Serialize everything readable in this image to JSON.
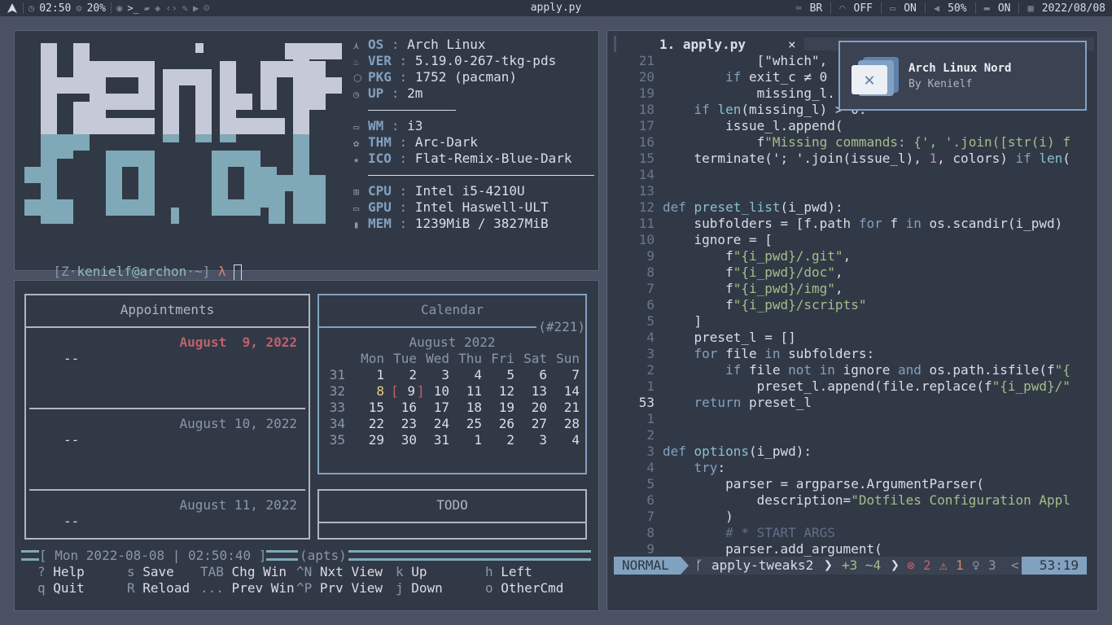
{
  "topbar": {
    "clock": "02:50",
    "cpu": "20%",
    "window_title": "apply.py",
    "keyboard": "BR",
    "wifi": "OFF",
    "display": "ON",
    "volume": "50%",
    "notifications": "ON",
    "date": "2022/08/08"
  },
  "logo": {
    "text": "Kenielf"
  },
  "sysinfo": [
    {
      "icon": "arch-icon",
      "label": "OS",
      "value": "Arch Linux"
    },
    {
      "icon": "flame-icon",
      "label": "VER",
      "value": "5.19.0-267-tkg-pds"
    },
    {
      "icon": "package-icon",
      "label": "PKG",
      "value": "1752 (pacman)"
    },
    {
      "icon": "clock-icon",
      "label": "UP",
      "value": "2m"
    },
    {
      "icon": "window-icon",
      "label": "WM",
      "value": "i3"
    },
    {
      "icon": "palette-icon",
      "label": "THM",
      "value": "Arc-Dark"
    },
    {
      "icon": "star-icon",
      "label": "ICO",
      "value": "Flat-Remix-Blue-Dark"
    },
    {
      "icon": "cpu-icon",
      "label": "CPU",
      "value": "Intel i5-4210U"
    },
    {
      "icon": "monitor-icon",
      "label": "GPU",
      "value": "Intel Haswell-ULT"
    },
    {
      "icon": "memory-icon",
      "label": "MEM",
      "value": "1239MiB / 3827MiB"
    }
  ],
  "prompt": {
    "open": "[Z",
    "user": "kenielf",
    "at": "@",
    "host": "archon",
    "path": "~",
    "close": "]",
    "symbol": "λ"
  },
  "calcurse": {
    "appointments_title": "Appointments",
    "appointments": [
      {
        "date": "August  9, 2022",
        "item": "--"
      },
      {
        "date": "August 10, 2022",
        "item": "--"
      },
      {
        "date": "August 11, 2022",
        "item": "--"
      }
    ],
    "calendar_title": "Calendar",
    "day_of_year": "(#221)",
    "month": "August 2022",
    "weekdays": [
      "Mon",
      "Tue",
      "Wed",
      "Thu",
      "Fri",
      "Sat",
      "Sun"
    ],
    "weeks": [
      {
        "wk": "31",
        "days": [
          "1",
          "2",
          "3",
          "4",
          "5",
          "6",
          "7"
        ]
      },
      {
        "wk": "32",
        "days": [
          "8",
          "9",
          "10",
          "11",
          "12",
          "13",
          "14"
        ]
      },
      {
        "wk": "33",
        "days": [
          "15",
          "16",
          "17",
          "18",
          "19",
          "20",
          "21"
        ]
      },
      {
        "wk": "34",
        "days": [
          "22",
          "23",
          "24",
          "25",
          "26",
          "27",
          "28"
        ]
      },
      {
        "wk": "35",
        "days": [
          "29",
          "30",
          "31",
          "1",
          "2",
          "3",
          "4"
        ]
      }
    ],
    "todo_title": "TODO",
    "status_date": "Mon 2022-08-08 | 02:50:40",
    "status_mode": "(apts)",
    "keys": [
      [
        {
          "k": "?",
          "d": "Help"
        },
        {
          "k": "s",
          "d": "Save"
        },
        {
          "k": "TAB",
          "d": "Chg Win"
        },
        {
          "k": "^N",
          "d": "Nxt View"
        },
        {
          "k": "k",
          "d": "Up"
        },
        {
          "k": "h",
          "d": "Left"
        }
      ],
      [
        {
          "k": "q",
          "d": "Quit"
        },
        {
          "k": "R",
          "d": "Reload"
        },
        {
          "k": "...",
          "d": "Prev Win"
        },
        {
          "k": "^P",
          "d": "Prv View"
        },
        {
          "k": "j",
          "d": "Down"
        },
        {
          "k": "o",
          "d": "OtherCmd"
        }
      ]
    ]
  },
  "editor": {
    "tab_label": "1. apply.py",
    "close": "×",
    "lines": [
      {
        "n": "21",
        "html": "        [\"which\", "
      },
      {
        "n": "20",
        "html": "    <span class=kw>if</span> exit_c ≠ 0"
      },
      {
        "n": "19",
        "html": "        missing_l."
      },
      {
        "n": "18",
        "html": "<span class=kw>if</span> <span class=fn>len</span>(missing_l) > 0:"
      },
      {
        "n": "17",
        "html": "    issue_l.append("
      },
      {
        "n": "16",
        "html": "        f<span class=st>\"Missing commands: {', '.join([str(i) f</span>"
      },
      {
        "n": "15",
        "html": "terminate('; '.join(issue_l), <span class=nm>1</span>, colors) <span class=kw>if</span> <span class=fn>len</span>("
      },
      {
        "n": "14",
        "html": ""
      },
      {
        "n": "13",
        "html": ""
      },
      {
        "n": "12",
        "html": "<span class=kw>def</span> <span class=fn>preset_list</span>(i_pwd):",
        "def": true
      },
      {
        "n": "11",
        "html": "subfolders = [f.path <span class=kw>for</span> f <span class=kw>in</span> os.scandir(i_pwd)"
      },
      {
        "n": "10",
        "html": "ignore = ["
      },
      {
        "n": "9",
        "html": "    f<span class=st>\"{i_pwd}/.git\"</span>,"
      },
      {
        "n": "8",
        "html": "    f<span class=st>\"{i_pwd}/doc\"</span>,"
      },
      {
        "n": "7",
        "html": "    f<span class=st>\"{i_pwd}/img\"</span>,"
      },
      {
        "n": "6",
        "html": "    f<span class=st>\"{i_pwd}/scripts\"</span>"
      },
      {
        "n": "5",
        "html": "]"
      },
      {
        "n": "4",
        "html": "preset_l = []"
      },
      {
        "n": "3",
        "html": "<span class=kw>for</span> file <span class=kw>in</span> subfolders:"
      },
      {
        "n": "2",
        "html": "    <span class=kw>if</span> file <span class=kw>not in</span> ignore <span class=kw>and</span> os.path.isfile(f<span class=st>\"{</span>"
      },
      {
        "n": "1",
        "html": "        preset_l.append(file.replace(f<span class=st>\"{i_pwd}/\"</span>"
      },
      {
        "n": "53",
        "html": "<span class=kw>return</span> preset_l",
        "cur": true
      },
      {
        "n": "1",
        "html": ""
      },
      {
        "n": "2",
        "html": ""
      },
      {
        "n": "3",
        "html": "<span class=kw>def</span> <span class=fn>options</span>(i_pwd):",
        "def": true
      },
      {
        "n": "4",
        "html": "<span class=kw>try</span>:"
      },
      {
        "n": "5",
        "html": "    parser = argparse.ArgumentParser("
      },
      {
        "n": "6",
        "html": "        description=<span class=st>\"Dotfiles Configuration Appl</span>"
      },
      {
        "n": "7",
        "html": "    )"
      },
      {
        "n": "8",
        "html": "    <span class=cm># * START ARGS</span>"
      },
      {
        "n": "9",
        "html": "    parser.add_argument("
      }
    ],
    "status": {
      "mode": "NORMAL",
      "branch": "apply-tweaks2",
      "diff": "+3 ~4",
      "errors": "2",
      "warnings": "1",
      "hints": "3",
      "position": "53:19"
    }
  },
  "notification": {
    "title": "Arch Linux Nord",
    "subtitle": "By Kenielf"
  },
  "colors": {
    "bg": "#4a5163",
    "panel": "#323946",
    "accent": "#81a1c1",
    "logo_top": "#c5cad6",
    "logo_bottom": "#7fa9b7"
  }
}
